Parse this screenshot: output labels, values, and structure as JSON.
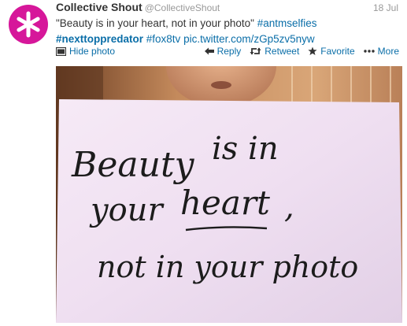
{
  "tweet": {
    "author_name": "Collective Shout",
    "author_handle": "@CollectiveShout",
    "timestamp": "18 Jul",
    "text_plain": "\"Beauty is in your heart, not in your photo\"",
    "hashtag1": "#antmselfies",
    "hashtag2": "#nexttoppredator",
    "hashtag3": "#fox8tv",
    "link": "pic.twitter.com/zGp5zv5nyw"
  },
  "actions": {
    "hide_photo": "Hide photo",
    "reply": "Reply",
    "retweet": "Retweet",
    "favorite": "Favorite",
    "more": "More"
  },
  "photo": {
    "line1a": "Beauty",
    "line1b": "is in",
    "line2a": "your",
    "line2b": "heart",
    "line2c": ",",
    "line3": "not in your photo"
  },
  "colors": {
    "avatar": "#d6179a",
    "link": "#0a6ea8",
    "ink": "#1c1c1c"
  },
  "icons": [
    "asterisk-logo-icon",
    "photo-icon",
    "reply-arrow-icon",
    "retweet-icon",
    "star-icon",
    "more-dots-icon"
  ]
}
